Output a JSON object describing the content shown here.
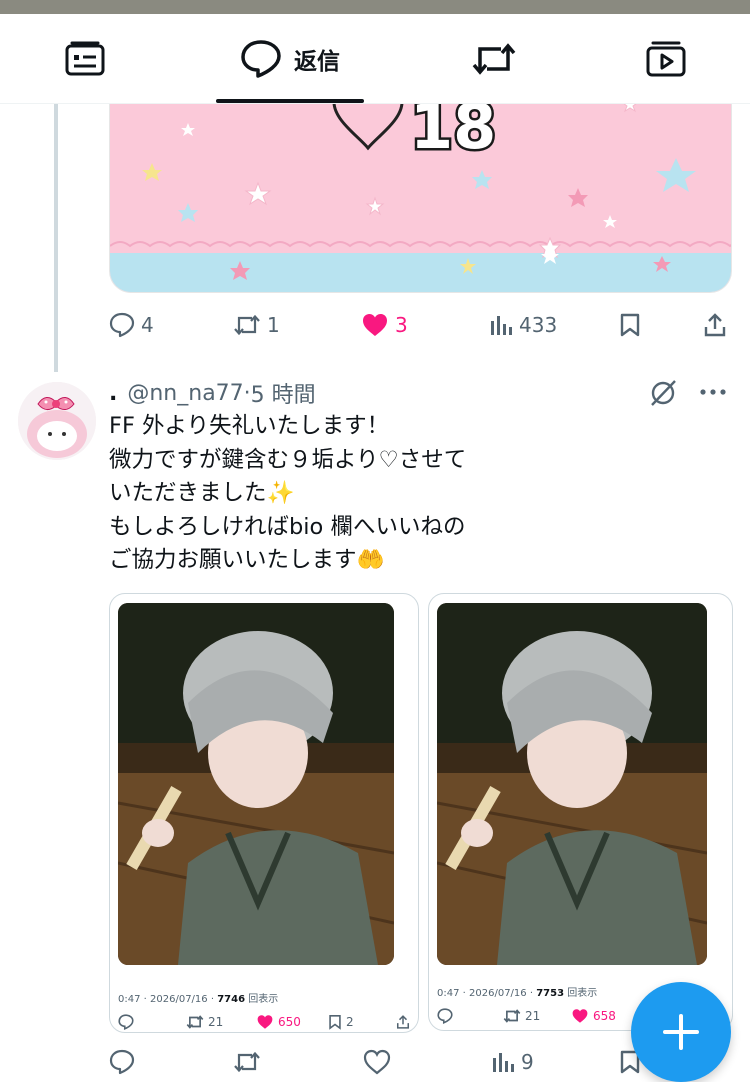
{
  "tabs": {
    "reply_label": "返信",
    "icons": [
      "article-icon",
      "reply-bubble-icon",
      "repost-icon",
      "video-icon"
    ]
  },
  "tweet1": {
    "image_text": "♡18",
    "stats": {
      "replies": "4",
      "reposts": "1",
      "likes": "3",
      "views": "433"
    },
    "like_color": "#f91880"
  },
  "tweet2": {
    "display_name": ".",
    "handle": "@nn_na77",
    "time": "5 時間",
    "text_lines": [
      "FF 外より失礼いたします！",
      "微力ですが鍵含む９垢より♡させて",
      "いただきました✨",
      "もしよろしければbio 欄へいいねの",
      "ご協力お願いいたします🤲"
    ],
    "stats": {
      "views": "9"
    },
    "cards": [
      {
        "time": "0:47",
        "date": "2026/07/16",
        "views": "7746",
        "views_suffix": "回表示",
        "reposts": "21",
        "likes": "650",
        "bookmarks": "2"
      },
      {
        "time": "0:47",
        "date": "2026/07/16",
        "views": "7753",
        "views_suffix": "回表示",
        "reposts": "21",
        "likes": "658",
        "bookmarks": ""
      }
    ]
  },
  "colors": {
    "accent": "#1d9bf0",
    "like": "#f91880",
    "muted": "#536471"
  }
}
